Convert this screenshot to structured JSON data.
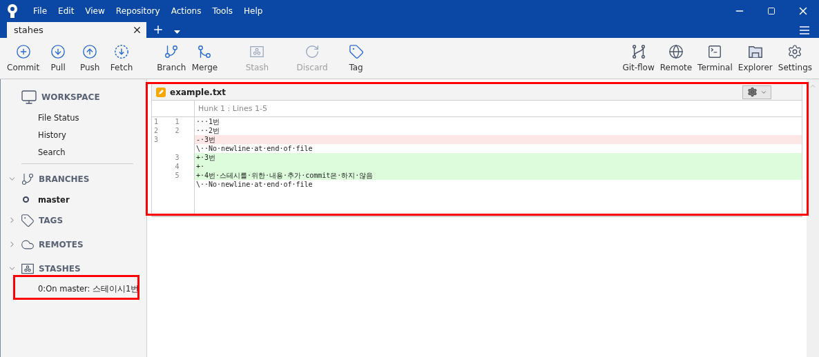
{
  "menu": [
    "File",
    "Edit",
    "View",
    "Repository",
    "Actions",
    "Tools",
    "Help"
  ],
  "tabs": [
    {
      "label": "stahes",
      "selected": true
    }
  ],
  "toolbar_left": [
    {
      "label": "Commit",
      "disabled": false
    },
    {
      "label": "Pull",
      "disabled": false
    },
    {
      "label": "Push",
      "disabled": false
    },
    {
      "label": "Fetch",
      "disabled": false
    },
    {
      "label": "Branch",
      "disabled": false
    },
    {
      "label": "Merge",
      "disabled": false
    },
    {
      "label": "Stash",
      "disabled": true
    },
    {
      "label": "Discard",
      "disabled": true
    },
    {
      "label": "Tag",
      "disabled": false
    }
  ],
  "toolbar_right": [
    "Git-flow",
    "Remote",
    "Terminal",
    "Explorer",
    "Settings"
  ],
  "sidebar": {
    "sections": [
      {
        "title": "WORKSPACE",
        "items": [
          {
            "label": "File Status",
            "current": false
          },
          {
            "label": "History",
            "current": false
          },
          {
            "label": "Search",
            "current": false
          }
        ]
      },
      {
        "title": "BRANCHES",
        "expanded": true,
        "items": [
          {
            "label": "master",
            "current": true
          }
        ]
      },
      {
        "title": "TAGS",
        "expanded": false
      },
      {
        "title": "REMOTES",
        "expanded": false
      },
      {
        "title": "STASHES",
        "expanded": true,
        "items": [
          {
            "label": "0:On master: 스테이시1번",
            "current": false
          }
        ]
      }
    ]
  },
  "diff": {
    "file": "example.txt",
    "hunk": "Hunk 1 : Lines 1-5",
    "lines": [
      {
        "old": "1",
        "new": "1",
        "kind": "context",
        "text": "···1번"
      },
      {
        "old": "2",
        "new": "2",
        "kind": "context",
        "text": "···2번"
      },
      {
        "old": "3",
        "kind": "removed",
        "text": "-·3번"
      },
      {
        "kind": "context",
        "text": "\\··No·newline·at·end·of·file"
      },
      {
        "new": "3",
        "kind": "added",
        "text": "+·3번"
      },
      {
        "new": "4",
        "kind": "added",
        "text": "+·"
      },
      {
        "new": "5",
        "kind": "added",
        "text": "+·4번·스테시를·위한·내용·추가·commit은·하지·않음"
      },
      {
        "kind": "context",
        "text": "\\··No·newline·at·end·of·file"
      }
    ]
  }
}
